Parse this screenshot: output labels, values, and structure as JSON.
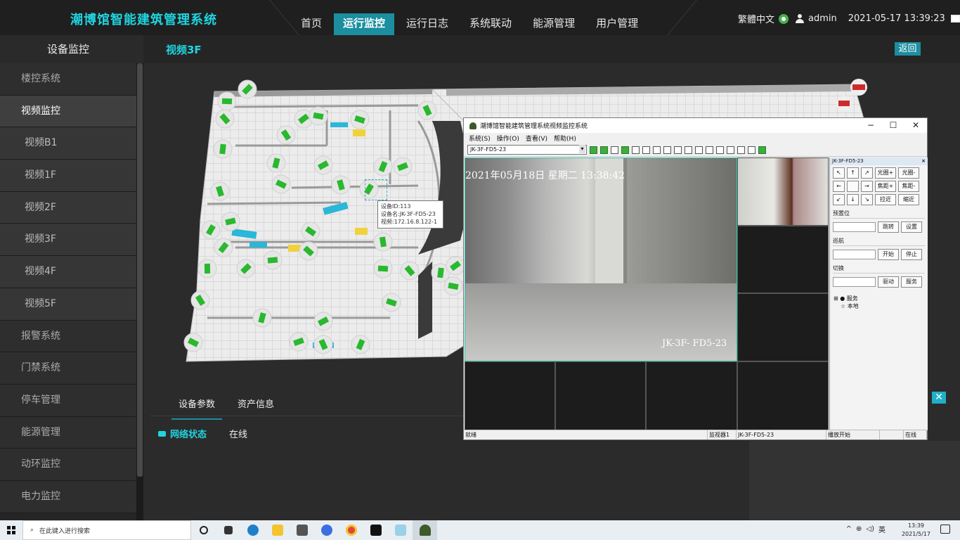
{
  "app": {
    "title": "潮博馆智能建筑管理系统"
  },
  "topnav": {
    "items": [
      "首页",
      "运行监控",
      "运行日志",
      "系统联动",
      "能源管理",
      "用户管理"
    ],
    "active_index": 1
  },
  "topright": {
    "language": "繁體中文",
    "user": "admin",
    "datetime": "2021-05-17 13:39:23"
  },
  "sidebar": {
    "title": "设备监控",
    "items": [
      {
        "label": "楼控系统"
      },
      {
        "label": "视频监控"
      },
      {
        "label": "视频B1"
      },
      {
        "label": "视频1F"
      },
      {
        "label": "视频2F"
      },
      {
        "label": "视频3F"
      },
      {
        "label": "视频4F"
      },
      {
        "label": "视频5F"
      },
      {
        "label": "报警系统"
      },
      {
        "label": "门禁系统"
      },
      {
        "label": "停车管理"
      },
      {
        "label": "能源管理"
      },
      {
        "label": "动环监控"
      },
      {
        "label": "电力监控"
      }
    ]
  },
  "content": {
    "title": "视频3F",
    "back_label": "返回"
  },
  "tooltip": {
    "line1": "设备ID:113",
    "line2": "设备名:JK-3F-FD5-23",
    "line3": "视频:172.16.8.122-1"
  },
  "tabs": {
    "items": [
      "设备参数",
      "资产信息"
    ]
  },
  "params": {
    "network_label": "网络状态",
    "network_value": "在线"
  },
  "close_label": "✕",
  "video_window": {
    "title": "潮博馆智能建筑管理系统视频监控系统",
    "menu": [
      "系统(S)",
      "操作(O)",
      "查看(V)",
      "帮助(H)"
    ],
    "camera_select": "JK-3F-FD5-23",
    "osd_time": "2021年05月18日  星期二  13:38:42",
    "osd_camera": "JK-3F- FD5-23",
    "ptz": {
      "header": "JK-3F-FD5-23",
      "header_close": "×",
      "iris_plus": "光圈+",
      "iris_minus": "光圈-",
      "focus_plus": "焦距+",
      "focus_minus": "焦距-",
      "zoom_in": "拉近",
      "zoom_out": "缩近",
      "preset_label": "预置位",
      "preset_go": "跳转",
      "preset_set": "设置",
      "cruise_label": "巡航",
      "cruise_start": "开始",
      "cruise_stop": "停止",
      "switch_label": "切换",
      "switch_drive": "驱动",
      "switch_service": "服务",
      "tree_root": "服务",
      "tree_child": "本地"
    },
    "status": {
      "state": "就绪",
      "monitor": "监视器1",
      "camera": "JK-3F-FD5-23",
      "play": "播放开始",
      "online": "在线"
    }
  },
  "taskbar": {
    "search_placeholder": "在此键入进行搜索",
    "tray_lang": "英",
    "time": "13:39",
    "date": "2021/5/17"
  }
}
